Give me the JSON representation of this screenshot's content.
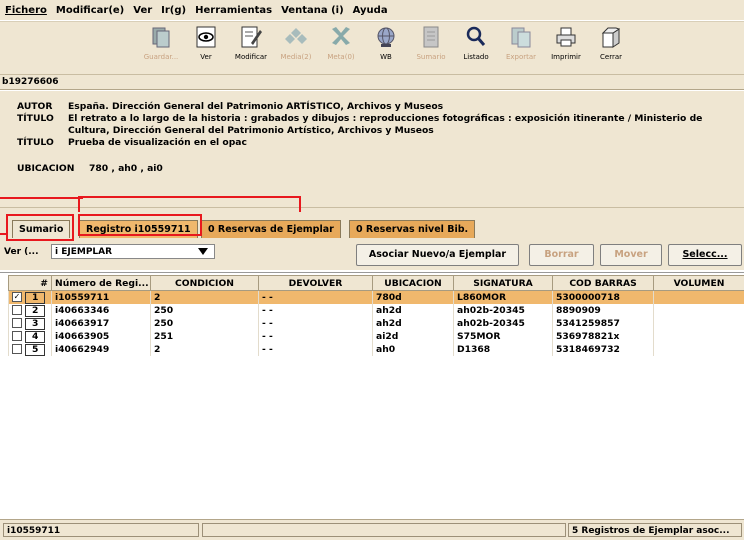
{
  "menu": [
    "Fichero",
    "Modificar(e)",
    "Ver",
    "Ir(g)",
    "Herramientas",
    "Ventana (i)",
    "Ayuda"
  ],
  "toolbar": [
    {
      "label": "Guardar...",
      "icon": "save-icon",
      "enabled": false
    },
    {
      "label": "Ver",
      "icon": "view-icon",
      "enabled": true
    },
    {
      "label": "Modificar",
      "icon": "edit-icon",
      "enabled": true
    },
    {
      "label": "Media(2)",
      "icon": "media-icon",
      "enabled": false
    },
    {
      "label": "Meta(0)",
      "icon": "meta-icon",
      "enabled": false
    },
    {
      "label": "WB",
      "icon": "globe-icon",
      "enabled": true
    },
    {
      "label": "Sumario",
      "icon": "summary-icon",
      "enabled": false
    },
    {
      "label": "Listado",
      "icon": "search-icon",
      "enabled": true
    },
    {
      "label": "Exportar",
      "icon": "export-icon",
      "enabled": false
    },
    {
      "label": "Imprimir",
      "icon": "print-icon",
      "enabled": true
    },
    {
      "label": "Cerrar",
      "icon": "close-icon",
      "enabled": true
    }
  ],
  "record_id": "b19276606",
  "record": {
    "autor_label": "AUTOR",
    "autor": "España. Dirección General del Patrimonio ARTÍSTICO, Archivos y Museos",
    "titulo_label": "TÍTULO",
    "titulo1_line1": "El retrato a lo largo de la historia : grabados y dibujos : reproducciones fotográficas : exposición itinerante / Ministerio de",
    "titulo1_line2": "Cultura, Dirección General del Patrimonio Artístico, Archivos y Museos",
    "titulo2": "Prueba de visualización en el opac",
    "ubicacion_label": "UBICACION",
    "ubicacion": "780 , ah0 , ai0"
  },
  "tabs": [
    {
      "label": "Sumario",
      "active": true
    },
    {
      "label": "Registro i10559711",
      "active": false
    },
    {
      "label": "0 Reservas de Ejemplar",
      "active": false
    },
    {
      "label": "0 Reservas nivel Bib.",
      "active": false
    }
  ],
  "options": {
    "ver_label": "Ver (...",
    "ver_value": "i EJEMPLAR",
    "asociar_label": "Asociar Nuevo/a Ejemplar",
    "borrar_label": "Borrar",
    "mover_label": "Mover",
    "seleccionar_label": "Selecc..."
  },
  "table": {
    "headers": [
      "#",
      "Número de Regi...",
      "CONDICION",
      "DEVOLVER",
      "UBICACION",
      "SIGNATURA",
      "COD BARRAS",
      "VOLUMEN"
    ],
    "rows": [
      {
        "checked": true,
        "n": "1",
        "numero": "i10559711",
        "condicion": "2",
        "devolver": "- -",
        "ubicacion": "780d",
        "signatura": "L860MOR",
        "cod_barras": "5300000718",
        "volumen": ""
      },
      {
        "checked": false,
        "n": "2",
        "numero": "i40663346",
        "condicion": "250",
        "devolver": "- -",
        "ubicacion": "ah2d",
        "signatura": "ah02b-20345",
        "cod_barras": "8890909",
        "volumen": ""
      },
      {
        "checked": false,
        "n": "3",
        "numero": "i40663917",
        "condicion": "250",
        "devolver": "- -",
        "ubicacion": "ah2d",
        "signatura": "ah02b-20345",
        "cod_barras": "5341259857",
        "volumen": ""
      },
      {
        "checked": false,
        "n": "4",
        "numero": "i40663905",
        "condicion": "251",
        "devolver": "- -",
        "ubicacion": "ai2d",
        "signatura": "S75MOR",
        "cod_barras": "536978821x",
        "volumen": ""
      },
      {
        "checked": false,
        "n": "5",
        "numero": "i40662949",
        "condicion": "2",
        "devolver": "- -",
        "ubicacion": "ah0",
        "signatura": "D1368",
        "cod_barras": "5318469732",
        "volumen": ""
      }
    ]
  },
  "status": {
    "left": "i10559711",
    "middle": "",
    "right": "5 Registros de Ejemplar asoc..."
  },
  "colors": {
    "highlight": "#e8181e",
    "selected_row": "#f0b86d",
    "panel": "#efe6d2"
  }
}
